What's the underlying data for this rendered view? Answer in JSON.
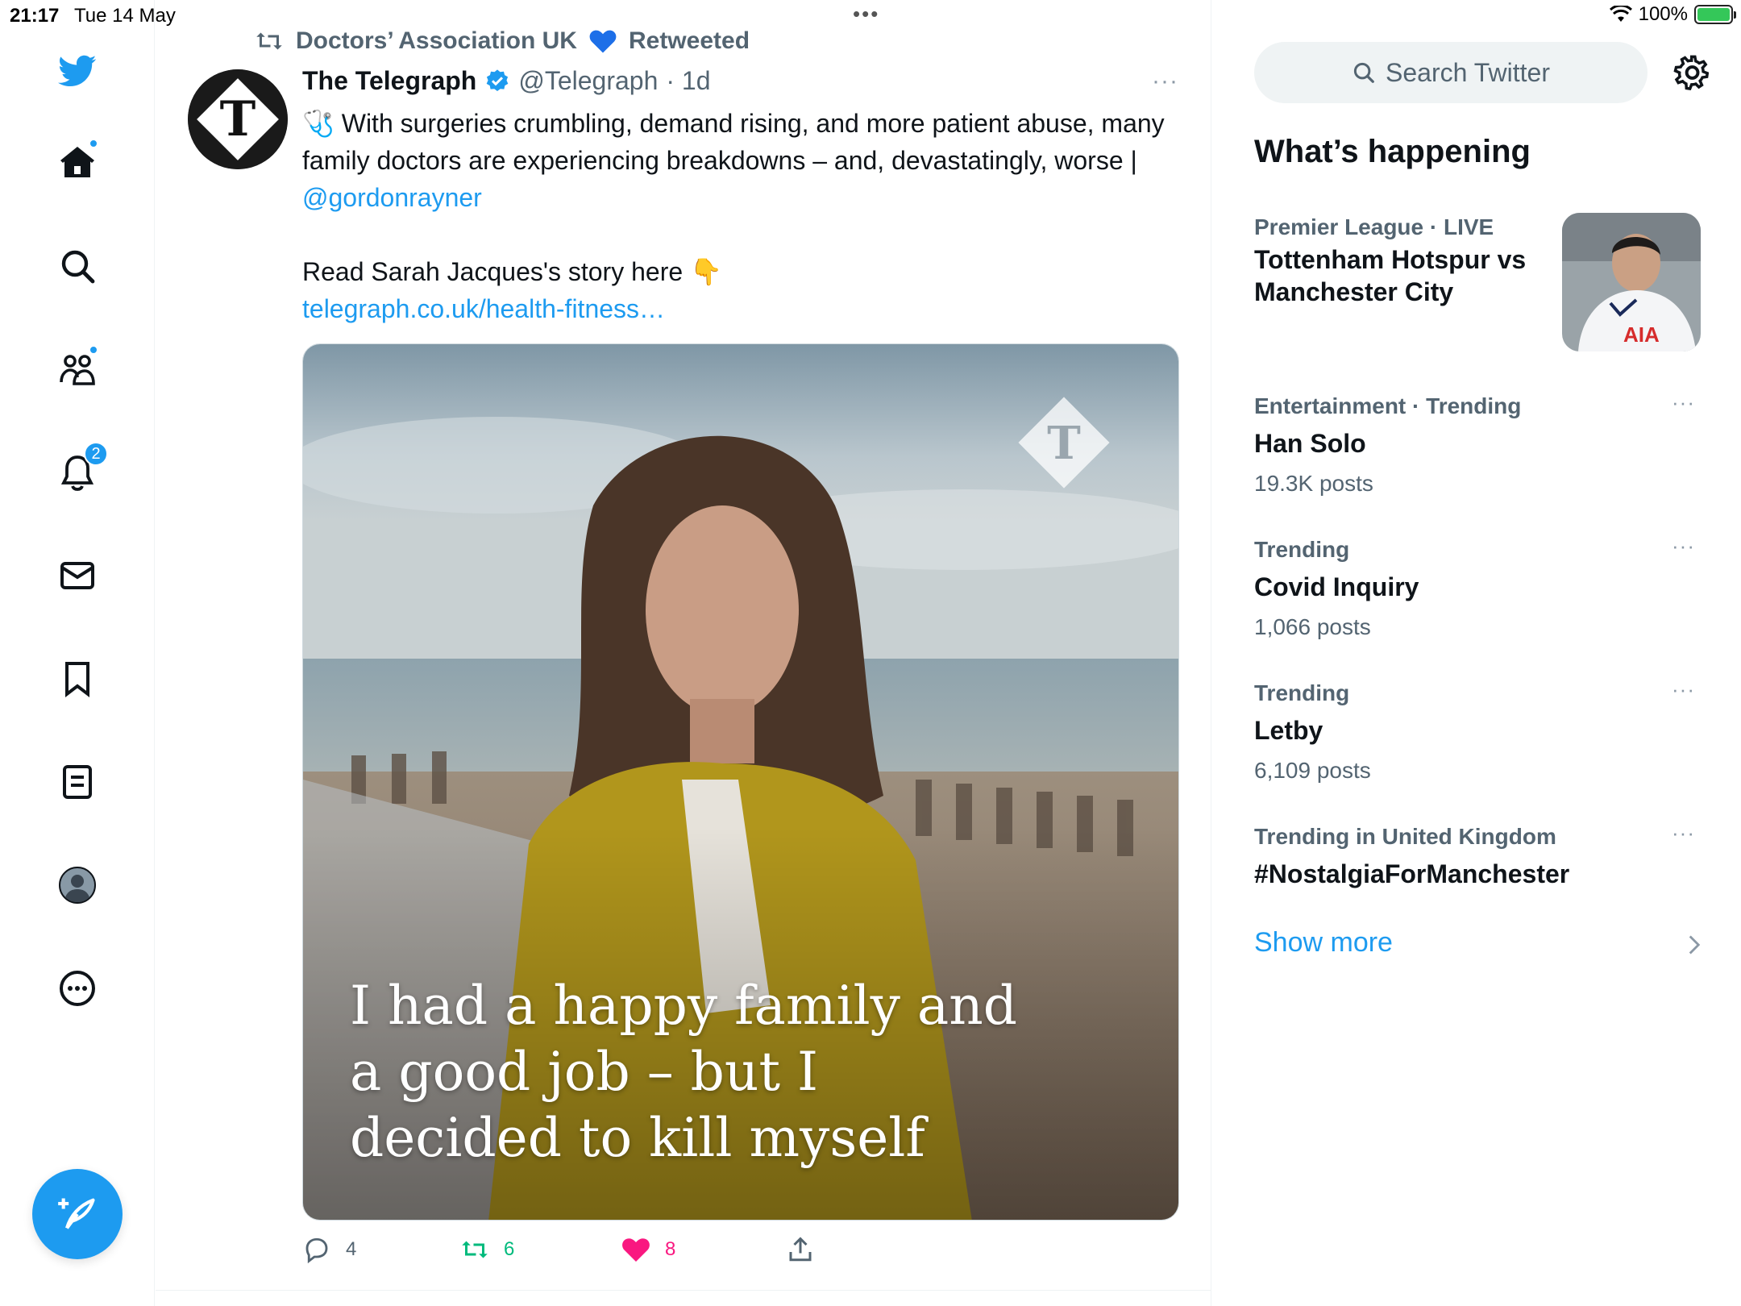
{
  "status_bar": {
    "time": "21:17",
    "date": "Tue 14 May",
    "battery": "100%"
  },
  "nav": {
    "items": [
      {
        "name": "twitter-logo-icon"
      },
      {
        "name": "home-icon",
        "dot": true
      },
      {
        "name": "search-icon"
      },
      {
        "name": "communities-icon",
        "dot": true
      },
      {
        "name": "notifications-icon",
        "badge": "2"
      },
      {
        "name": "messages-icon"
      },
      {
        "name": "bookmarks-icon"
      },
      {
        "name": "lists-icon"
      },
      {
        "name": "profile-icon"
      },
      {
        "name": "more-icon"
      }
    ],
    "notifications_badge": "2",
    "compose_icon": "compose-tweet-icon"
  },
  "tweet": {
    "retweeted_by": "Doctors’ Association UK",
    "retweeted_label": "Retweeted",
    "author_name": "The Telegraph",
    "author_handle": "@Telegraph",
    "time": "· 1d",
    "more": "···",
    "text_line1": "🩺 With surgeries crumbling, demand rising, and more patient abuse, many family doctors are experiencing breakdowns – and, devastatingly, worse |",
    "mention": "@gordonrayner",
    "text_line2": "Read Sarah Jacques's story here 👇",
    "link": "telegraph.co.uk/health-fitness…",
    "media_headline": "I had a happy family and a good job – but I decided to kill myself",
    "actions": {
      "replies": "4",
      "retweets": "6",
      "likes": "8"
    }
  },
  "sidebar": {
    "search_placeholder": "Search Twitter",
    "trends_title": "What’s happening",
    "trends": [
      {
        "meta": "Premier League · LIVE",
        "name": "Tottenham Hotspur vs Manchester City",
        "count": ""
      },
      {
        "meta": "Entertainment · Trending",
        "name": "Han Solo",
        "count": "19.3K posts"
      },
      {
        "meta": "Trending",
        "name": "Covid Inquiry",
        "count": "1,066 posts"
      },
      {
        "meta": "Trending",
        "name": "Letby",
        "count": "6,109 posts"
      },
      {
        "meta": "Trending in United Kingdom",
        "name": "#NostalgiaForManchester",
        "count": ""
      }
    ],
    "show_more": "Show more"
  },
  "colors": {
    "accent": "#1d9bf0",
    "retweet": "#00ba7c",
    "like": "#f91880",
    "secondary_text": "#536471"
  }
}
